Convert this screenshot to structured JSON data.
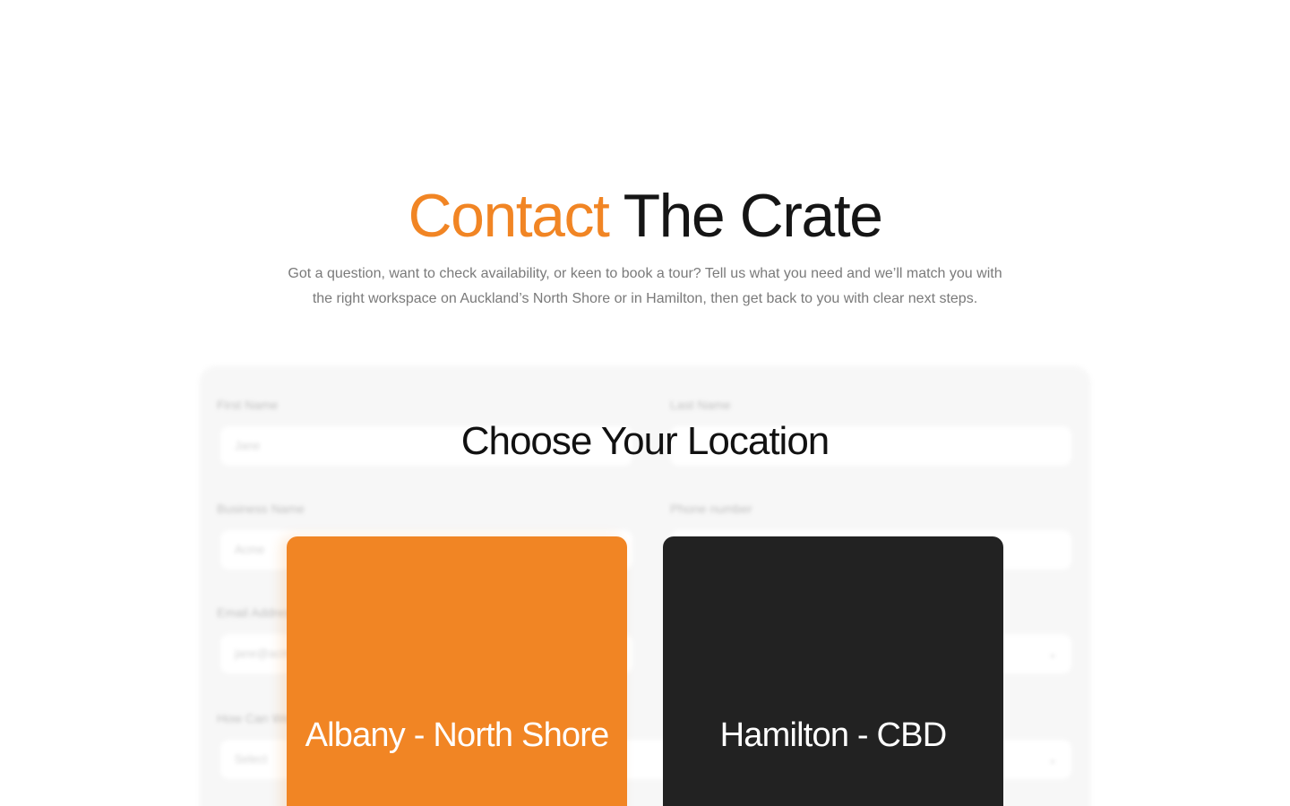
{
  "hero": {
    "title_accent": "Contact",
    "title_rest": "The Crate",
    "subtitle": "Got a question, want to check availability, or keen to book a tour? Tell us what you need and we’ll match you with the right workspace on Auckland’s North Shore or in Hamilton, then get back to you with clear next steps."
  },
  "colors": {
    "accent": "#f18524",
    "dark_card": "#222222",
    "form_bg": "#f7f7f7"
  },
  "form": {
    "first_name_label": "First Name",
    "first_name_placeholder": "Jane",
    "last_name_label": "Last Name",
    "business_name_label": "Business Name",
    "business_name_placeholder": "Acme",
    "phone_label": "Phone number",
    "email_label": "Email Address",
    "email_placeholder": "jane@acme.com",
    "how_label": "How Can We Help",
    "how_value": "Select"
  },
  "chooser": {
    "title": "Choose Your Location",
    "locations": [
      {
        "label": "Albany - North Shore"
      },
      {
        "label": "Hamilton - CBD"
      }
    ]
  }
}
